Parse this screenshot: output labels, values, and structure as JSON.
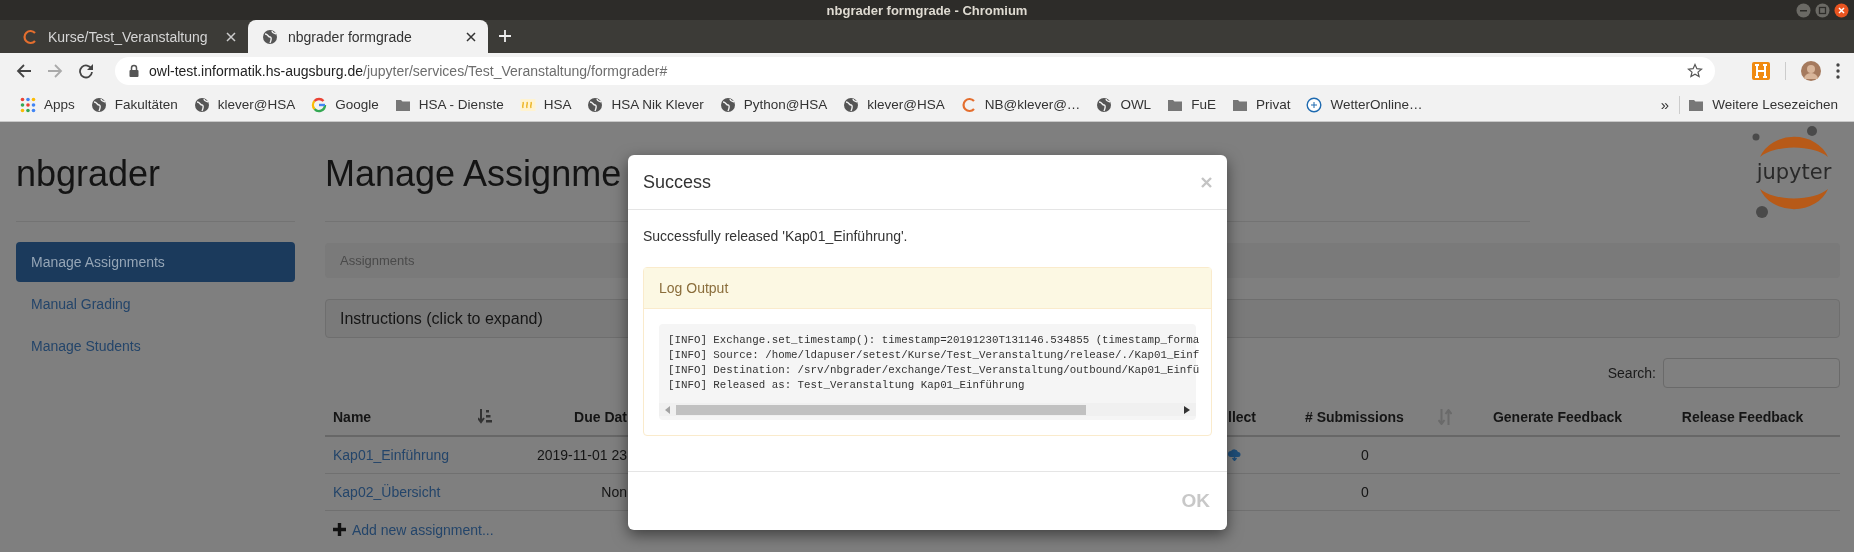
{
  "window": {
    "title": "nbgrader formgrade - Chromium"
  },
  "tabs": [
    {
      "title": "Kurse/Test_Veranstaltung",
      "kind": "spinner",
      "selected": false
    },
    {
      "title": "nbgrader formgrade",
      "kind": "globe",
      "selected": true
    }
  ],
  "toolbar": {
    "forward_disabled": true,
    "url": {
      "host": "owl-test.informatik.hs-augsburg.de",
      "path": "/jupyter/services/Test_Veranstaltung/formgrader#"
    }
  },
  "bookmarks": [
    {
      "label": "Apps",
      "kind": "apps"
    },
    {
      "label": "Fakultäten",
      "kind": "globe"
    },
    {
      "label": "klever@HSA",
      "kind": "globe"
    },
    {
      "label": "Google",
      "kind": "google"
    },
    {
      "label": "HSA - Dienste",
      "kind": "folder"
    },
    {
      "label": "HSA",
      "kind": "hsa"
    },
    {
      "label": "HSA Nik Klever",
      "kind": "globe"
    },
    {
      "label": "Python@HSA",
      "kind": "globe"
    },
    {
      "label": "klever@HSA",
      "kind": "globe"
    },
    {
      "label": "NB@klever@…",
      "kind": "spinner"
    },
    {
      "label": "OWL",
      "kind": "globe"
    },
    {
      "label": "FuE",
      "kind": "folder"
    },
    {
      "label": "Privat",
      "kind": "folder"
    },
    {
      "label": "WetterOnline…",
      "kind": "weather"
    }
  ],
  "bookmarks_overflow": "»",
  "other_bookmarks": {
    "label": "Weitere Lesezeichen",
    "kind": "folder"
  },
  "sidebar": {
    "title": "nbgrader",
    "items": [
      {
        "label": "Manage Assignments",
        "selected": true
      },
      {
        "label": "Manual Grading",
        "selected": false
      },
      {
        "label": "Manage Students",
        "selected": false
      }
    ]
  },
  "main": {
    "title": "Manage Assignme",
    "logo": "jupyter",
    "breadcrumb": "Assignments",
    "instructions": "Instructions (click to expand)",
    "search": {
      "label": "Search:"
    }
  },
  "table": {
    "columns": [
      {
        "label": "Name",
        "sorted": true
      },
      {
        "label": "Due Dat"
      },
      {
        "label": "llect"
      },
      {
        "label": "# Submissions",
        "sorted": false
      },
      {
        "label": "Generate Feedback"
      },
      {
        "label": "Release Feedback"
      }
    ],
    "rows": [
      {
        "name": "Kap01_Einführung",
        "due": "2019-11-01 23",
        "collect_icon": true,
        "submissions": "0"
      },
      {
        "name": "Kap02_Übersicht",
        "due": "Non",
        "collect_icon": false,
        "submissions": "0"
      }
    ],
    "add_link": "Add new assignment..."
  },
  "modal": {
    "title": "Success",
    "message": "Successfully released 'Kap01_Einführung'.",
    "panel_title": "Log Output",
    "log": [
      "[INFO] Exchange.set_timestamp(): timestamp=20191230T131146.534855 (timestamp_forma",
      "[INFO] Source: /home/ldapuser/setest/Kurse/Test_Veranstaltung/release/./Kap01_Einf",
      "[INFO] Destination: /srv/nbgrader/exchange/Test_Veranstaltung/outbound/Kap01_Einfü",
      "[INFO] Released as: Test_Veranstaltung Kap01_Einführung"
    ],
    "button": "OK"
  }
}
